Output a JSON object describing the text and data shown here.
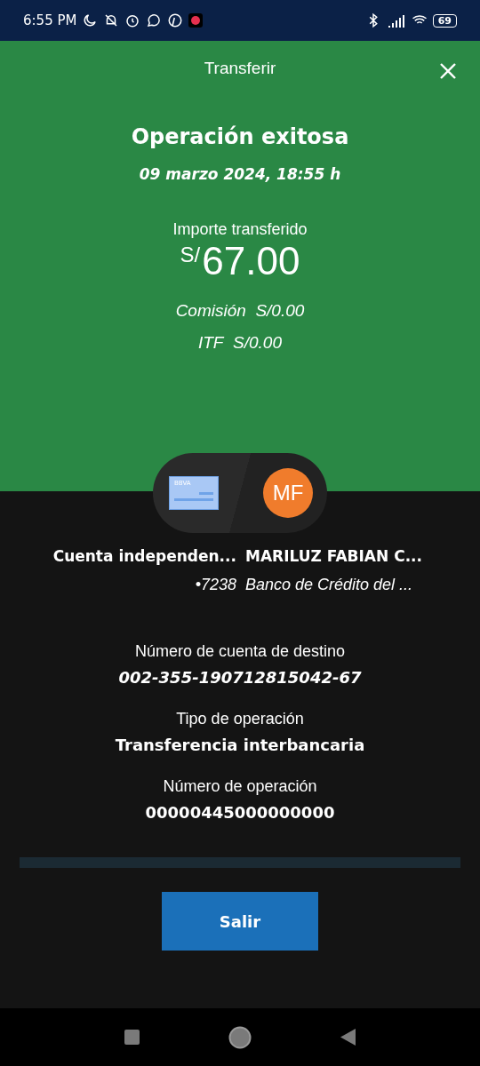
{
  "status_bar": {
    "time": "6:55 PM",
    "battery": "69"
  },
  "header": {
    "title": "Transferir"
  },
  "summary": {
    "title": "Operación exitosa",
    "date": "09 marzo 2024, 18:55 h",
    "amount_label": "Importe transferido",
    "currency": "S/",
    "amount": "67.00",
    "fees": [
      {
        "label": "Comisión",
        "value": "S/0.00"
      },
      {
        "label": "ITF",
        "value": "S/0.00"
      }
    ]
  },
  "origin": {
    "card_label": "BBVA",
    "name": "Cuenta independen...",
    "detail": "•7238"
  },
  "destination": {
    "initials": "MF",
    "name": "MARILUZ FABIAN C...",
    "detail": "Banco de Crédito del ..."
  },
  "details": [
    {
      "label": "Número de cuenta de destino",
      "value": "002-355-190712815042-67",
      "italic": true
    },
    {
      "label": "Tipo de operación",
      "value": "Transferencia interbancaria",
      "italic": false
    },
    {
      "label": "Número de operación",
      "value": "00000445000000000",
      "italic": false
    }
  ],
  "buttons": [
    "Salir"
  ]
}
